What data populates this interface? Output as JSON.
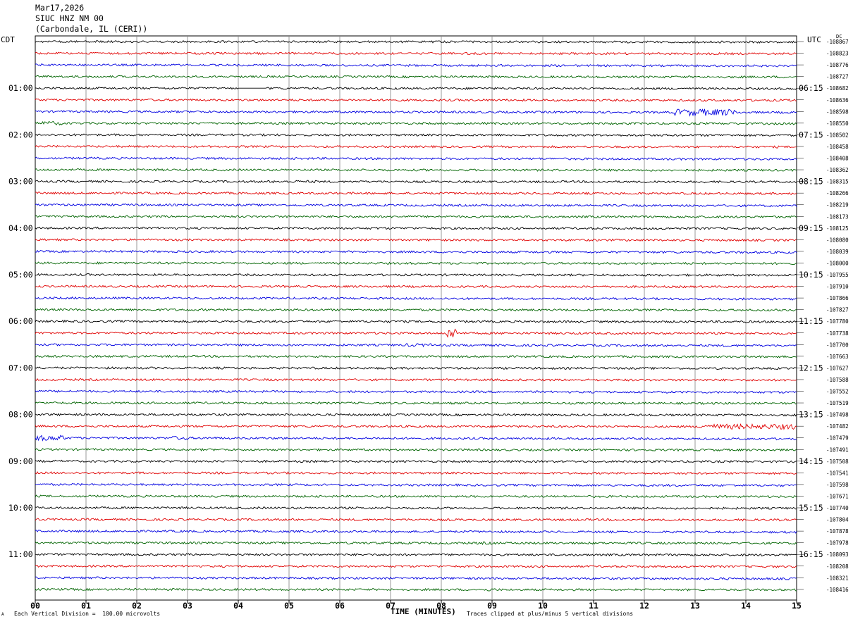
{
  "header": {
    "date": "Mar17,2026",
    "station": "SIUC HNZ NM 00",
    "location": "(Carbondale, IL (CERI))"
  },
  "left_tz": "CDT",
  "right_tz": "UTC",
  "dc_label": "DC",
  "footer": {
    "scale_note": "Each Vertical Division =  100.00 microvolts",
    "clip_note": "Traces clipped at plus/minus 5 vertical divisions",
    "corner_mark": "A"
  },
  "colors": {
    "trace_cycle": [
      "#000000",
      "#e00000",
      "#0000e0",
      "#006400"
    ],
    "grid": "#808080"
  },
  "chart_data": {
    "type": "line",
    "title": "",
    "xlabel": "TIME (MINUTES)",
    "xlim": [
      0,
      15
    ],
    "x_ticks": [
      "00",
      "01",
      "02",
      "03",
      "04",
      "05",
      "06",
      "07",
      "08",
      "09",
      "10",
      "11",
      "12",
      "13",
      "14",
      "15"
    ],
    "rows_count": 48,
    "row_interval_minutes": 15,
    "left_hour_labels": [
      "01:00",
      "02:00",
      "03:00",
      "04:00",
      "05:00",
      "06:00",
      "07:00",
      "08:00",
      "09:00",
      "10:00",
      "11:00"
    ],
    "right_hour_labels": [
      "06:15",
      "07:15",
      "08:15",
      "09:15",
      "10:15",
      "11:15",
      "12:15",
      "13:15",
      "14:15",
      "15:15",
      "16:15"
    ],
    "dc_offsets": [
      "-108867",
      "-108823",
      "-108776",
      "-108727",
      "-108682",
      "-108636",
      "-108598",
      "-108550",
      "-108502",
      "-108458",
      "-108408",
      "-108362",
      "-108315",
      "-108266",
      "-108219",
      "-108173",
      "-108125",
      "-108080",
      "-108039",
      "-108000",
      "-107955",
      "-107910",
      "-107866",
      "-107827",
      "-107780",
      "-107738",
      "-107700",
      "-107663",
      "-107627",
      "-107588",
      "-107552",
      "-107519",
      "-107498",
      "-107482",
      "-107479",
      "-107491",
      "-107508",
      "-107541",
      "-107598",
      "-107671",
      "-107740",
      "-107804",
      "-107878",
      "-107978",
      "-108093",
      "-108208",
      "-108321",
      "-108416"
    ],
    "events": [
      {
        "row": 4,
        "start": 4.0,
        "end": 4.55,
        "kind": "gap"
      },
      {
        "row": 6,
        "start": 12.6,
        "end": 13.8,
        "kind": "burst",
        "amp": 3.2
      },
      {
        "row": 7,
        "start": 0.1,
        "end": 0.6,
        "kind": "burst",
        "amp": 1.8
      },
      {
        "row": 12,
        "start": 4.6,
        "end": 5.6,
        "kind": "burst",
        "amp": 1.2
      },
      {
        "row": 25,
        "start": 8.1,
        "end": 8.3,
        "kind": "spike",
        "amp": 2.0
      },
      {
        "row": 26,
        "start": 7.3,
        "end": 7.8,
        "kind": "burst",
        "amp": 1.5
      },
      {
        "row": 33,
        "start": 13.1,
        "end": 15.0,
        "kind": "burst",
        "amp": 2.4
      },
      {
        "row": 34,
        "start": 0.0,
        "end": 0.6,
        "kind": "burst",
        "amp": 2.5
      },
      {
        "row": 34,
        "start": 2.7,
        "end": 3.0,
        "kind": "burst",
        "amp": 1.8
      },
      {
        "row": 43,
        "start": 8.7,
        "end": 9.1,
        "kind": "burst",
        "amp": 1.3
      },
      {
        "row": 47,
        "start": 2.4,
        "end": 2.8,
        "kind": "burst",
        "amp": 1.1
      },
      {
        "row": 47,
        "start": 8.9,
        "end": 9.1,
        "kind": "burst",
        "amp": 1.4
      }
    ]
  }
}
